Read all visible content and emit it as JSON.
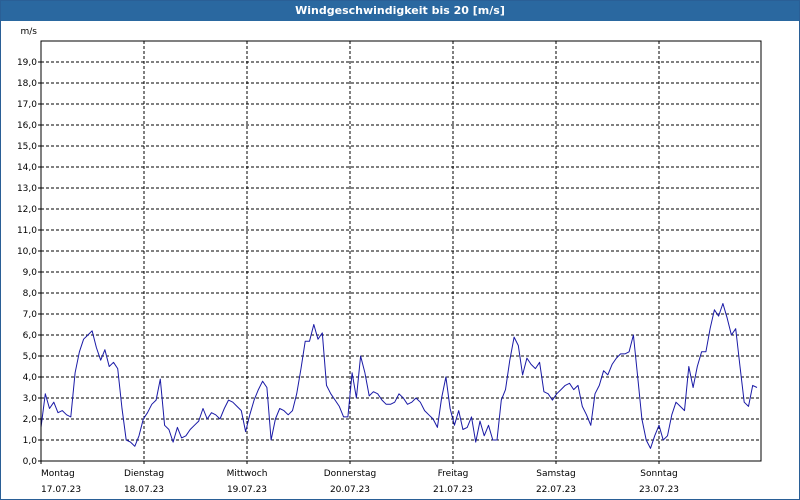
{
  "title": "Windgeschwindigkeit bis 20 [m/s]",
  "colors": {
    "titlebar": "#2a68a0",
    "line": "#1a1aa6",
    "grid": "#000000"
  },
  "chart_data": {
    "type": "line",
    "ylabel": "m/s",
    "ylim": [
      0,
      20
    ],
    "ytick_step": 1,
    "yticks": [
      "0,0",
      "1,0",
      "2,0",
      "3,0",
      "4,0",
      "5,0",
      "6,0",
      "7,0",
      "8,0",
      "9,0",
      "10,0",
      "11,0",
      "12,0",
      "13,0",
      "14,0",
      "15,0",
      "16,0",
      "17,0",
      "18,0",
      "19,0"
    ],
    "grid": true,
    "xlabels": [
      {
        "day": "Montag",
        "date": "17.07.23"
      },
      {
        "day": "Dienstag",
        "date": "18.07.23"
      },
      {
        "day": "Mittwoch",
        "date": "19.07.23"
      },
      {
        "day": "Donnerstag",
        "date": "20.07.23"
      },
      {
        "day": "Freitag",
        "date": "21.07.23"
      },
      {
        "day": "Samstag",
        "date": "22.07.23"
      },
      {
        "day": "Sonntag",
        "date": "23.07.23"
      }
    ],
    "series": [
      {
        "values": [
          1.6,
          3.2,
          2.5,
          2.8,
          2.3,
          2.4,
          2.2,
          2.1,
          4.2,
          5.2,
          5.8,
          6.0,
          6.2,
          5.4,
          4.8,
          5.3,
          4.5,
          4.7,
          4.4,
          2.5,
          1.0,
          0.9,
          0.7,
          1.2,
          2.0,
          2.3,
          2.7,
          2.9,
          3.9,
          1.7,
          1.5,
          0.9,
          1.6,
          1.1,
          1.2,
          1.5,
          1.7,
          1.9,
          2.5,
          2.0,
          2.3,
          2.2,
          2.0,
          2.5,
          2.9,
          2.8,
          2.6,
          2.4,
          1.4,
          2.2,
          2.9,
          3.4,
          3.8,
          3.5,
          1.0,
          2.0,
          2.5,
          2.4,
          2.2,
          2.4,
          3.2,
          4.4,
          5.7,
          5.7,
          6.5,
          5.8,
          6.1,
          3.6,
          3.2,
          2.9,
          2.6,
          2.1,
          2.1,
          4.2,
          3.0,
          5.0,
          4.2,
          3.1,
          3.3,
          3.2,
          2.9,
          2.7,
          2.7,
          2.8,
          3.2,
          3.0,
          2.7,
          2.8,
          3.0,
          2.8,
          2.4,
          2.2,
          2.0,
          1.6,
          3.0,
          4.0,
          2.5,
          1.7,
          2.4,
          1.5,
          1.6,
          2.1,
          0.9,
          1.9,
          1.2,
          1.7,
          1.0,
          1.0,
          2.9,
          3.4,
          4.8,
          5.9,
          5.5,
          4.1,
          4.9,
          4.6,
          4.4,
          4.7,
          3.3,
          3.2,
          2.9,
          3.2,
          3.4,
          3.6,
          3.7,
          3.4,
          3.6,
          2.6,
          2.2,
          1.7,
          3.2,
          3.6,
          4.3,
          4.1,
          4.6,
          4.9,
          5.1,
          5.1,
          5.2,
          6.0,
          4.0,
          2.0,
          1.0,
          0.6,
          1.2,
          1.7,
          1.0,
          1.2,
          2.2,
          2.8,
          2.6,
          2.4,
          4.5,
          3.5,
          4.5,
          5.2,
          5.2,
          6.3,
          7.2,
          6.9,
          7.5,
          6.8,
          6.0,
          6.3,
          4.5,
          2.8,
          2.6,
          3.6,
          3.5
        ]
      }
    ]
  }
}
